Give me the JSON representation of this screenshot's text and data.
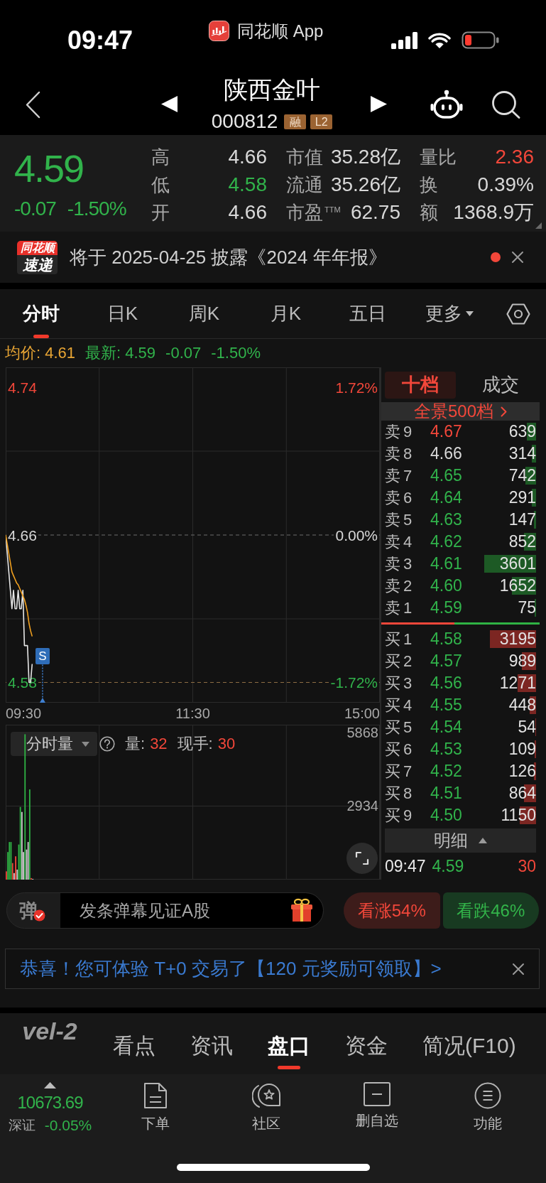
{
  "status_bar": {
    "time": "09:47",
    "app_name": "同花顺 App"
  },
  "header": {
    "title": "陕西金叶",
    "code": "000812",
    "tags": [
      "融",
      "L2"
    ]
  },
  "quote": {
    "price": "4.59",
    "change": "-0.07",
    "change_pct": "-1.50%",
    "color": "#31b34b",
    "stats": [
      {
        "label": "高",
        "value": "4.66",
        "color": "#d8d8d8"
      },
      {
        "label": "市值",
        "value": "35.28亿",
        "color": "#d8d8d8"
      },
      {
        "label": "量比",
        "value": "2.36",
        "color": "#f2473a"
      },
      {
        "label": "低",
        "value": "4.58",
        "color": "#31b34b"
      },
      {
        "label": "流通",
        "value": "35.26亿",
        "color": "#d8d8d8"
      },
      {
        "label": "换",
        "value": "0.39%",
        "color": "#d8d8d8"
      },
      {
        "label": "开",
        "value": "4.66",
        "color": "#d8d8d8"
      },
      {
        "label": "市盈$^{TTM}$",
        "value": "62.75",
        "color": "#d8d8d8"
      },
      {
        "label": "额",
        "value": "1368.9万",
        "color": "#d8d8d8"
      }
    ]
  },
  "notice": {
    "logo_top": "同花顺",
    "logo_bottom": "速递",
    "text": "将于 2025-04-25 披露《2024 年年报》",
    "unread": true
  },
  "chart_tabs": [
    {
      "label": "分时",
      "selected": true,
      "dropdown": false
    },
    {
      "label": "日K",
      "selected": false,
      "dropdown": false
    },
    {
      "label": "周K",
      "selected": false,
      "dropdown": false
    },
    {
      "label": "月K",
      "selected": false,
      "dropdown": false
    },
    {
      "label": "五日",
      "selected": false,
      "dropdown": false
    },
    {
      "label": "更多",
      "selected": false,
      "dropdown": true
    }
  ],
  "intraday": {
    "summary": [
      {
        "text": "均价: 4.61",
        "color": "#e8a534"
      },
      {
        "text": "最新: 4.59",
        "color": "#31b34b"
      },
      {
        "text": "-0.07",
        "color": "#31b34b"
      },
      {
        "text": "-1.50%",
        "color": "#31b34b"
      }
    ],
    "price_chart": {
      "chart_data": {
        "type": "line",
        "categories": [
          null,
          null,
          null,
          null,
          null,
          null,
          null,
          null,
          null,
          null,
          null,
          null,
          null,
          null,
          null,
          null,
          null,
          null,
          null,
          null,
          null,
          null,
          null,
          null,
          null,
          null,
          null,
          null,
          null,
          null,
          null,
          null,
          null,
          null,
          null,
          null,
          null,
          null,
          null,
          null,
          null,
          null,
          null,
          null,
          null,
          null,
          null,
          null,
          null,
          null,
          null,
          null,
          null,
          null,
          null,
          null,
          null,
          null,
          null,
          null,
          null,
          null,
          null,
          null,
          null,
          null,
          null,
          null,
          null,
          null,
          null,
          null,
          null,
          null,
          null,
          null,
          null,
          null,
          null,
          null,
          null,
          null,
          null,
          null,
          null,
          null,
          null,
          null,
          null,
          null,
          null,
          null,
          null,
          null,
          null,
          null,
          null,
          null,
          null,
          null,
          null,
          null,
          null,
          null,
          null,
          null,
          null,
          null,
          null,
          null,
          null,
          null,
          null,
          null,
          null,
          null,
          null,
          null,
          null,
          null,
          null,
          null,
          null,
          null,
          null,
          null,
          null,
          null,
          null,
          null,
          null,
          null,
          null,
          null,
          null,
          null,
          null,
          null,
          null,
          null,
          null,
          null,
          null,
          null,
          null,
          null,
          null,
          null,
          null,
          null,
          null,
          null,
          null,
          null,
          null,
          null,
          null,
          null,
          null,
          null,
          null,
          null,
          null,
          null,
          null,
          null,
          null,
          null,
          null,
          null,
          null,
          null,
          null,
          null,
          null,
          null,
          null,
          null,
          null,
          null,
          null,
          null,
          null,
          null,
          null,
          null,
          null,
          null,
          null,
          null,
          null,
          null,
          null,
          null,
          null,
          null,
          null,
          null,
          null,
          null,
          null,
          null,
          null,
          null,
          null,
          null,
          null,
          null,
          null,
          null,
          null,
          null,
          null,
          null,
          null,
          null,
          null,
          null,
          null,
          null,
          null,
          null,
          null,
          null,
          null,
          null,
          null,
          null,
          null,
          null,
          null,
          null,
          null,
          null,
          null,
          null,
          null,
          null,
          null,
          null,
          null
        ],
        "ylim": [
          4.569,
          4.751
        ],
        "yticks": [
          {
            "value": 4.74,
            "label": "4.74"
          },
          {
            "value": 4.66,
            "label": "4.66"
          },
          {
            "value": 4.58,
            "label": "4.58"
          }
        ],
        "ref_lines": [
          {
            "axis": "y",
            "value": 4.66,
            "color": "#6c6c6c"
          },
          {
            "axis": "y",
            "value": 4.58,
            "color": "#8f7045"
          }
        ],
        "series": [
          {
            "color": "#e6e6e6",
            "values": [
              4.66,
              4.65,
              4.64,
              4.63,
              4.62,
              4.63,
              4.62,
              4.62,
              4.63,
              4.62,
              4.62,
              4.63,
              4.6,
              4.6,
              4.6,
              4.58,
              4.58,
              4.59,
              null,
              null,
              null,
              null,
              null,
              null,
              null,
              null,
              null,
              null,
              null,
              null,
              null,
              null,
              null,
              null,
              null,
              null,
              null,
              null,
              null,
              null,
              null,
              null,
              null,
              null,
              null,
              null,
              null,
              null,
              null,
              null,
              null,
              null,
              null,
              null,
              null,
              null,
              null,
              null,
              null,
              null,
              null,
              null,
              null,
              null,
              null,
              null,
              null,
              null,
              null,
              null,
              null,
              null,
              null,
              null,
              null,
              null,
              null,
              null,
              null,
              null,
              null,
              null,
              null,
              null,
              null,
              null,
              null,
              null,
              null,
              null,
              null,
              null,
              null,
              null,
              null,
              null,
              null,
              null,
              null,
              null,
              null,
              null,
              null,
              null,
              null,
              null,
              null,
              null,
              null,
              null,
              null,
              null,
              null,
              null,
              null,
              null,
              null,
              null,
              null,
              null,
              null,
              null,
              null,
              null,
              null,
              null,
              null,
              null,
              null,
              null,
              null,
              null,
              null,
              null,
              null,
              null,
              null,
              null,
              null,
              null,
              null,
              null,
              null,
              null,
              null,
              null,
              null,
              null,
              null,
              null,
              null,
              null,
              null,
              null,
              null,
              null,
              null,
              null,
              null,
              null,
              null,
              null,
              null,
              null,
              null,
              null,
              null,
              null,
              null,
              null,
              null,
              null,
              null,
              null,
              null,
              null,
              null,
              null,
              null,
              null,
              null,
              null,
              null,
              null,
              null,
              null,
              null,
              null,
              null,
              null,
              null,
              null,
              null,
              null,
              null,
              null,
              null,
              null,
              null,
              null,
              null,
              null,
              null,
              null,
              null,
              null,
              null,
              null,
              null,
              null,
              null,
              null,
              null,
              null,
              null,
              null,
              null,
              null,
              null,
              null,
              null,
              null,
              null,
              null,
              null,
              null,
              null,
              null,
              null,
              null,
              null,
              null,
              null,
              null,
              null,
              null,
              null,
              null,
              null,
              null,
              null
            ]
          },
          {
            "color": "#f0a020",
            "values": [
              4.66,
              4.655,
              4.65,
              4.645,
              4.64,
              4.638,
              4.636,
              4.634,
              4.633,
              4.631,
              4.629,
              4.627,
              4.625,
              4.622,
              4.618,
              4.612,
              4.608,
              4.605,
              null,
              null,
              null,
              null,
              null,
              null,
              null,
              null,
              null,
              null,
              null,
              null,
              null,
              null,
              null,
              null,
              null,
              null,
              null,
              null,
              null,
              null,
              null,
              null,
              null,
              null,
              null,
              null,
              null,
              null,
              null,
              null,
              null,
              null,
              null,
              null,
              null,
              null,
              null,
              null,
              null,
              null,
              null,
              null,
              null,
              null,
              null,
              null,
              null,
              null,
              null,
              null,
              null,
              null,
              null,
              null,
              null,
              null,
              null,
              null,
              null,
              null,
              null,
              null,
              null,
              null,
              null,
              null,
              null,
              null,
              null,
              null,
              null,
              null,
              null,
              null,
              null,
              null,
              null,
              null,
              null,
              null,
              null,
              null,
              null,
              null,
              null,
              null,
              null,
              null,
              null,
              null,
              null,
              null,
              null,
              null,
              null,
              null,
              null,
              null,
              null,
              null,
              null,
              null,
              null,
              null,
              null,
              null,
              null,
              null,
              null,
              null,
              null,
              null,
              null,
              null,
              null,
              null,
              null,
              null,
              null,
              null,
              null,
              null,
              null,
              null,
              null,
              null,
              null,
              null,
              null,
              null,
              null,
              null,
              null,
              null,
              null,
              null,
              null,
              null,
              null,
              null,
              null,
              null,
              null,
              null,
              null,
              null,
              null,
              null,
              null,
              null,
              null,
              null,
              null,
              null,
              null,
              null,
              null,
              null,
              null,
              null,
              null,
              null,
              null,
              null,
              null,
              null,
              null,
              null,
              null,
              null,
              null,
              null,
              null,
              null,
              null,
              null,
              null,
              null,
              null,
              null,
              null,
              null,
              null,
              null,
              null,
              null,
              null,
              null,
              null,
              null,
              null,
              null,
              null,
              null,
              null,
              null,
              null,
              null,
              null,
              null,
              null,
              null,
              null,
              null,
              null,
              null,
              null,
              null,
              null,
              null,
              null,
              null,
              null,
              null,
              null,
              null,
              null,
              null,
              null,
              null,
              null
            ]
          }
        ],
        "annotations": [
          "S"
        ]
      },
      "percent_labels": [
        "1.72%",
        "0.00%",
        "-1.72%"
      ],
      "time_labels": [
        "09:30",
        "11:30",
        "15:00"
      ]
    },
    "volume_chart": {
      "selector": "分时量",
      "stats": [
        {
          "label": "量:",
          "value": "32"
        },
        {
          "label": "现手:",
          "value": "30"
        }
      ],
      "chart_data": {
        "type": "bar",
        "categories": [
          null,
          null,
          null,
          null,
          null,
          null,
          null,
          null,
          null,
          null,
          null,
          null,
          null,
          null,
          null,
          null,
          null,
          null,
          null,
          null,
          null,
          null,
          null,
          null,
          null,
          null,
          null,
          null,
          null,
          null,
          null,
          null,
          null,
          null,
          null,
          null,
          null,
          null,
          null,
          null,
          null,
          null,
          null,
          null,
          null,
          null,
          null,
          null,
          null,
          null,
          null,
          null,
          null,
          null,
          null,
          null,
          null,
          null,
          null,
          null,
          null,
          null,
          null,
          null,
          null,
          null,
          null,
          null,
          null,
          null,
          null,
          null,
          null,
          null,
          null,
          null,
          null,
          null,
          null,
          null,
          null,
          null,
          null,
          null,
          null,
          null,
          null,
          null,
          null,
          null,
          null,
          null,
          null,
          null,
          null,
          null,
          null,
          null,
          null,
          null,
          null,
          null,
          null,
          null,
          null,
          null,
          null,
          null,
          null,
          null,
          null,
          null,
          null,
          null,
          null,
          null,
          null,
          null,
          null,
          null,
          null,
          null,
          null,
          null,
          null,
          null,
          null,
          null,
          null,
          null,
          null,
          null,
          null,
          null,
          null,
          null,
          null,
          null,
          null,
          null,
          null,
          null,
          null,
          null,
          null,
          null,
          null,
          null,
          null,
          null,
          null,
          null,
          null,
          null,
          null,
          null,
          null,
          null,
          null,
          null,
          null,
          null,
          null,
          null,
          null,
          null,
          null,
          null,
          null,
          null,
          null,
          null,
          null,
          null,
          null,
          null,
          null,
          null,
          null,
          null,
          null,
          null,
          null,
          null,
          null,
          null,
          null,
          null,
          null,
          null,
          null,
          null,
          null,
          null,
          null,
          null,
          null,
          null,
          null,
          null,
          null,
          null,
          null,
          null,
          null,
          null,
          null,
          null,
          null,
          null,
          null,
          null,
          null,
          null,
          null,
          null,
          null,
          null,
          null,
          null,
          null,
          null,
          null,
          null,
          null,
          null,
          null,
          null,
          null,
          null,
          null,
          null,
          null,
          null,
          null,
          null,
          null,
          null,
          null,
          null,
          null
        ],
        "ylim": [
          0,
          6180
        ],
        "yticks": [
          {
            "value": 2934,
            "label": "2934"
          },
          {
            "value": 5868,
            "label": "5868"
          }
        ],
        "series": [
          {
            "color": "#f2473a",
            "values": [
              330,
              null,
              null,
              null,
              660,
              null,
              930,
              null,
              null,
              null,
              null,
              null,
              null,
              null,
              null,
              null,
              60,
              null,
              null,
              null,
              null,
              null,
              null,
              null,
              null,
              null,
              null,
              null,
              null,
              null,
              null,
              null,
              null,
              null,
              null,
              null,
              null,
              null,
              null,
              null,
              null,
              null,
              null,
              null,
              null,
              null,
              null,
              null,
              null,
              null,
              null,
              null,
              null,
              null,
              null,
              null,
              null,
              null,
              null,
              null,
              null,
              null,
              null,
              null,
              null,
              null,
              null,
              null,
              null,
              null,
              null,
              null,
              null,
              null,
              null,
              null,
              null,
              null,
              null,
              null,
              null,
              null,
              null,
              null,
              null,
              null,
              null,
              null,
              null,
              null,
              null,
              null,
              null,
              null,
              null,
              null,
              null,
              null,
              null,
              null,
              null,
              null,
              null,
              null,
              null,
              null,
              null,
              null,
              null,
              null,
              null,
              null,
              null,
              null,
              null,
              null,
              null,
              null,
              null,
              null,
              null,
              null,
              null,
              null,
              null,
              null,
              null,
              null,
              null,
              null,
              null,
              null,
              null,
              null,
              null,
              null,
              null,
              null,
              null,
              null,
              null,
              null,
              null,
              null,
              null,
              null,
              null,
              null,
              null,
              null,
              null,
              null,
              null,
              null,
              null,
              null,
              null,
              null,
              null,
              null,
              null,
              null,
              null,
              null,
              null,
              null,
              null,
              null,
              null,
              null,
              null,
              null,
              null,
              null,
              null,
              null,
              null,
              null,
              null,
              null,
              null,
              null,
              null,
              null,
              null,
              null,
              null,
              null,
              null,
              null,
              null,
              null,
              null,
              null,
              null,
              null,
              null,
              null,
              null,
              null,
              null,
              null,
              null,
              null,
              null,
              null,
              null,
              null,
              null,
              null,
              null,
              null,
              null,
              null,
              null,
              null,
              null,
              null,
              null,
              null,
              null,
              null,
              null,
              null,
              null,
              null,
              null,
              null,
              null,
              null,
              null,
              null,
              null,
              null,
              null,
              null,
              null,
              null,
              null,
              null,
              null
            ]
          },
          {
            "color": "#2fb344",
            "values": [
              null,
              1100,
              1500,
              1500,
              null,
              null,
              null,
              null,
              1400,
              2900,
              null,
              null,
              5800,
              null,
              null,
              3600,
              null,
              null,
              null,
              null,
              null,
              null,
              null,
              null,
              null,
              null,
              null,
              null,
              null,
              null,
              null,
              null,
              null,
              null,
              null,
              null,
              null,
              null,
              null,
              null,
              null,
              null,
              null,
              null,
              null,
              null,
              null,
              null,
              null,
              null,
              null,
              null,
              null,
              null,
              null,
              null,
              null,
              null,
              null,
              null,
              null,
              null,
              null,
              null,
              null,
              null,
              null,
              null,
              null,
              null,
              null,
              null,
              null,
              null,
              null,
              null,
              null,
              null,
              null,
              null,
              null,
              null,
              null,
              null,
              null,
              null,
              null,
              null,
              null,
              null,
              null,
              null,
              null,
              null,
              null,
              null,
              null,
              null,
              null,
              null,
              null,
              null,
              null,
              null,
              null,
              null,
              null,
              null,
              null,
              null,
              null,
              null,
              null,
              null,
              null,
              null,
              null,
              null,
              null,
              null,
              null,
              null,
              null,
              null,
              null,
              null,
              null,
              null,
              null,
              null,
              null,
              null,
              null,
              null,
              null,
              null,
              null,
              null,
              null,
              null,
              null,
              null,
              null,
              null,
              null,
              null,
              null,
              null,
              null,
              null,
              null,
              null,
              null,
              null,
              null,
              null,
              null,
              null,
              null,
              null,
              null,
              null,
              null,
              null,
              null,
              null,
              null,
              null,
              null,
              null,
              null,
              null,
              null,
              null,
              null,
              null,
              null,
              null,
              null,
              null,
              null,
              null,
              null,
              null,
              null,
              null,
              null,
              null,
              null,
              null,
              null,
              null,
              null,
              null,
              null,
              null,
              null,
              null,
              null,
              null,
              null,
              null,
              null,
              null,
              null,
              null,
              null,
              null,
              null,
              null,
              null,
              null,
              null,
              null,
              null,
              null,
              null,
              null,
              null,
              null,
              null,
              null,
              null,
              null,
              null,
              null,
              null,
              null,
              null,
              null,
              null,
              null,
              null,
              null,
              null,
              null,
              null,
              null,
              null,
              null,
              null
            ]
          },
          {
            "color": "#cfcfcf",
            "values": [
              null,
              null,
              null,
              null,
              null,
              260,
              null,
              400,
              null,
              null,
              2700,
              1100,
              null,
              1200,
              1500,
              null,
              null,
              30,
              null,
              null,
              null,
              null,
              null,
              null,
              null,
              null,
              null,
              null,
              null,
              null,
              null,
              null,
              null,
              null,
              null,
              null,
              null,
              null,
              null,
              null,
              null,
              null,
              null,
              null,
              null,
              null,
              null,
              null,
              null,
              null,
              null,
              null,
              null,
              null,
              null,
              null,
              null,
              null,
              null,
              null,
              null,
              null,
              null,
              null,
              null,
              null,
              null,
              null,
              null,
              null,
              null,
              null,
              null,
              null,
              null,
              null,
              null,
              null,
              null,
              null,
              null,
              null,
              null,
              null,
              null,
              null,
              null,
              null,
              null,
              null,
              null,
              null,
              null,
              null,
              null,
              null,
              null,
              null,
              null,
              null,
              null,
              null,
              null,
              null,
              null,
              null,
              null,
              null,
              null,
              null,
              null,
              null,
              null,
              null,
              null,
              null,
              null,
              null,
              null,
              null,
              null,
              null,
              null,
              null,
              null,
              null,
              null,
              null,
              null,
              null,
              null,
              null,
              null,
              null,
              null,
              null,
              null,
              null,
              null,
              null,
              null,
              null,
              null,
              null,
              null,
              null,
              null,
              null,
              null,
              null,
              null,
              null,
              null,
              null,
              null,
              null,
              null,
              null,
              null,
              null,
              null,
              null,
              null,
              null,
              null,
              null,
              null,
              null,
              null,
              null,
              null,
              null,
              null,
              null,
              null,
              null,
              null,
              null,
              null,
              null,
              null,
              null,
              null,
              null,
              null,
              null,
              null,
              null,
              null,
              null,
              null,
              null,
              null,
              null,
              null,
              null,
              null,
              null,
              null,
              null,
              null,
              null,
              null,
              null,
              null,
              null,
              null,
              null,
              null,
              null,
              null,
              null,
              null,
              null,
              null,
              null,
              null,
              null,
              null,
              null,
              null,
              null,
              null,
              null,
              null,
              null,
              null,
              null,
              null,
              null,
              null,
              null,
              null,
              null,
              null,
              null,
              null,
              null,
              null,
              null,
              null
            ]
          }
        ]
      }
    }
  },
  "order_book": {
    "tabs": [
      {
        "label": "十档",
        "selected": true
      },
      {
        "label": "成交",
        "selected": false
      }
    ],
    "depth_link": "全景500档",
    "asks": [
      {
        "label": "卖9",
        "price": "4.67",
        "volume": "639",
        "color": "#f2473a"
      },
      {
        "label": "卖8",
        "price": "4.66",
        "volume": "314",
        "color": "#d8d8d8"
      },
      {
        "label": "卖7",
        "price": "4.65",
        "volume": "742",
        "color": "#31b34b"
      },
      {
        "label": "卖6",
        "price": "4.64",
        "volume": "291",
        "color": "#31b34b"
      },
      {
        "label": "卖5",
        "price": "4.63",
        "volume": "147",
        "color": "#31b34b"
      },
      {
        "label": "卖4",
        "price": "4.62",
        "volume": "852",
        "color": "#31b34b"
      },
      {
        "label": "卖3",
        "price": "4.61",
        "volume": "3601",
        "color": "#31b34b"
      },
      {
        "label": "卖2",
        "price": "4.60",
        "volume": "1652",
        "color": "#31b34b"
      },
      {
        "label": "卖1",
        "price": "4.59",
        "volume": "75",
        "color": "#31b34b"
      }
    ],
    "ratio_bar": {
      "level": 0.46
    },
    "bids": [
      {
        "label": "买1",
        "price": "4.58",
        "volume": "3195",
        "color": "#31b34b"
      },
      {
        "label": "买2",
        "price": "4.57",
        "volume": "989",
        "color": "#31b34b"
      },
      {
        "label": "买3",
        "price": "4.56",
        "volume": "1271",
        "color": "#31b34b"
      },
      {
        "label": "买4",
        "price": "4.55",
        "volume": "448",
        "color": "#31b34b"
      },
      {
        "label": "买5",
        "price": "4.54",
        "volume": "54",
        "color": "#31b34b"
      },
      {
        "label": "买6",
        "price": "4.53",
        "volume": "109",
        "color": "#31b34b"
      },
      {
        "label": "买7",
        "price": "4.52",
        "volume": "126",
        "color": "#31b34b"
      },
      {
        "label": "买8",
        "price": "4.51",
        "volume": "864",
        "color": "#31b34b"
      },
      {
        "label": "买9",
        "price": "4.50",
        "volume": "1150",
        "color": "#31b34b"
      }
    ],
    "detail_button": "明细",
    "last_trade": {
      "time": "09:47",
      "price": {
        "text": "4.59",
        "color": "#31b34b"
      },
      "volume": {
        "text": "30",
        "color": "#f2473a"
      }
    }
  },
  "social": {
    "badge": "弹",
    "placeholder": "发条弹幕见证A股",
    "votes": [
      {
        "label": "看涨54%",
        "kind": "bull"
      },
      {
        "label": "看跌46%",
        "kind": "bear"
      }
    ]
  },
  "promo": {
    "text": "恭喜！您可体验 T+0 交易了【120 元奖励可领取】>"
  },
  "section_tabs": [
    {
      "label": "vel-2",
      "kind": "logo",
      "selected": false
    },
    {
      "label": "看点",
      "kind": "text",
      "selected": false
    },
    {
      "label": "资讯",
      "kind": "text",
      "selected": false
    },
    {
      "label": "盘口",
      "kind": "text",
      "selected": true
    },
    {
      "label": "资金",
      "kind": "text",
      "selected": false
    },
    {
      "label": "简况(F10)",
      "kind": "text",
      "selected": false
    }
  ],
  "toolbar": {
    "index": {
      "value": "10673.69",
      "name": "深证",
      "change": "-0.05%",
      "color": "#31b34b"
    },
    "buttons": [
      {
        "label": "下单",
        "kind": "order"
      },
      {
        "label": "社区",
        "kind": "community"
      },
      {
        "label": "删自选",
        "kind": "remove_watchlist"
      },
      {
        "label": "功能",
        "kind": "functions"
      }
    ]
  }
}
